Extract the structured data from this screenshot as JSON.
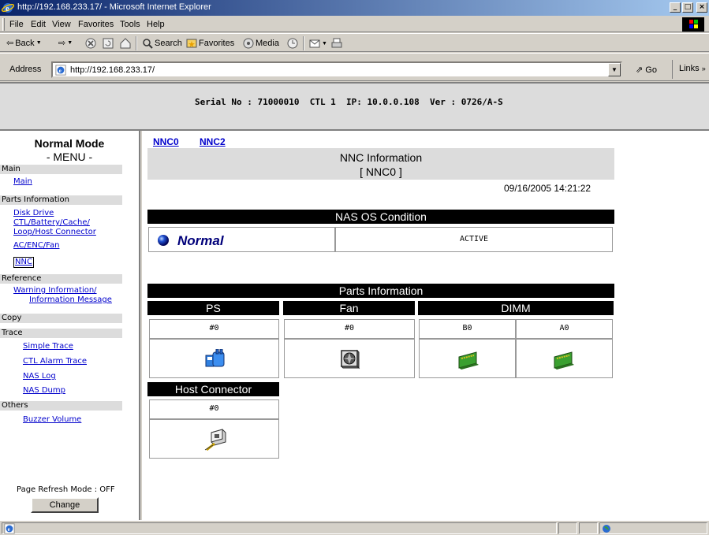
{
  "window": {
    "title": "http://192.168.233.17/ - Microsoft Internet Explorer",
    "minimize": "_",
    "maximize": "□",
    "close": "×"
  },
  "menu": [
    "File",
    "Edit",
    "View",
    "Favorites",
    "Tools",
    "Help"
  ],
  "toolbar": {
    "back": "Back",
    "search": "Search",
    "favorites": "Favorites",
    "media": "Media"
  },
  "address": {
    "label": "Address",
    "url": "http://192.168.233.17/",
    "go": "Go",
    "links": "Links"
  },
  "header": {
    "serial": "Serial No : 71000010  CTL 1  IP: 10.0.0.108  Ver : 0726/A-S"
  },
  "left_menu": {
    "mode": "Normal Mode",
    "menu_title": "- MENU -",
    "sections": {
      "main": "Main",
      "parts": "Parts Information",
      "reference": "Reference",
      "copy": "Copy",
      "trace": "Trace",
      "others": "Others"
    },
    "links": {
      "main": "Main",
      "disk_drive": "Disk Drive",
      "ctl_line1": "CTL/Battery/Cache/",
      "ctl_line2": "Loop/Host Connector",
      "ac_enc_fan": "AC/ENC/Fan",
      "nnc": "NNC",
      "warn_line1": "Warning Information/",
      "warn_line2": "Information Message",
      "simple_trace": "Simple Trace",
      "ctl_alarm_trace": "CTL Alarm Trace",
      "nas_log": "NAS Log",
      "nas_dump": "NAS Dump",
      "buzzer_volume": "Buzzer Volume"
    },
    "refresh_mode": "Page Refresh Mode : OFF",
    "change": "Change"
  },
  "content": {
    "tabs": [
      "NNC0",
      "NNC2"
    ],
    "title": "NNC Information",
    "subtitle": "[ NNC0 ]",
    "datetime": "09/16/2005 14:21:22",
    "nas_os": {
      "header": "NAS OS Condition",
      "status": "Normal",
      "state": "ACTIVE"
    },
    "parts": {
      "header": "Parts Information",
      "ps": {
        "header": "PS",
        "id": "#0"
      },
      "fan": {
        "header": "Fan",
        "id": "#0"
      },
      "dimm": {
        "header": "DIMM",
        "ids": [
          "B0",
          "A0"
        ]
      },
      "host": {
        "header": "Host Connector",
        "id": "#0"
      }
    }
  },
  "colors": {
    "link": "#0000cc",
    "status_normal": "#00007a",
    "header_bg": "#000000",
    "title_gradient_start": "#0a246a"
  }
}
